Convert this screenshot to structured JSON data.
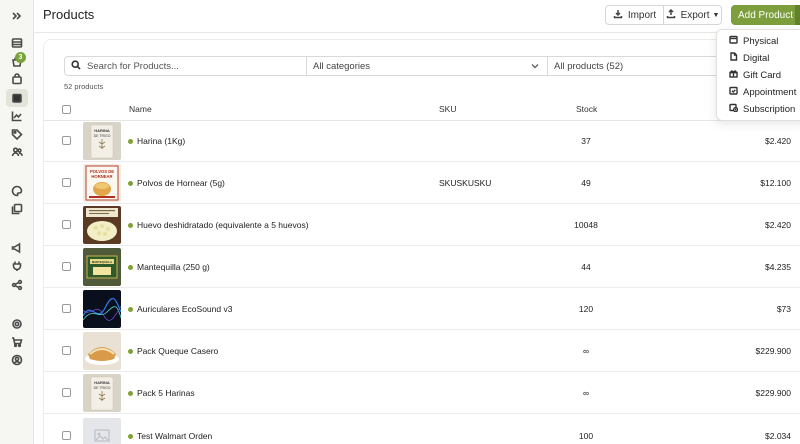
{
  "page": {
    "title": "Products"
  },
  "toolbar": {
    "import_label": "Import",
    "export_label": "Export",
    "add_label": "Add Product"
  },
  "add_menu": {
    "items": [
      {
        "label": "Physical",
        "icon": "box-icon"
      },
      {
        "label": "Digital",
        "icon": "file-icon"
      },
      {
        "label": "Gift Card",
        "icon": "gift-icon"
      },
      {
        "label": "Appointment",
        "icon": "calendar-check-icon"
      },
      {
        "label": "Subscription",
        "icon": "calendar-clock-icon"
      }
    ]
  },
  "sidebar": {
    "badge": "3",
    "icons": [
      "expand-icon",
      "storefront-icon",
      "orders-icon",
      "bag-icon",
      "products-icon",
      "analytics-icon",
      "tag-icon",
      "customers-icon",
      "palette-icon",
      "pages-icon",
      "megaphone-icon",
      "plug-icon",
      "share-icon",
      "settings-icon",
      "cart-icon",
      "account-icon"
    ]
  },
  "filters": {
    "search_placeholder": "Search for Products...",
    "category": "All categories",
    "products": "All products (52)"
  },
  "count_text": "52 products",
  "table": {
    "headers": {
      "name": "Name",
      "sku": "SKU",
      "stock": "Stock"
    },
    "rows": [
      {
        "name": "Harina (1Kg)",
        "sku": "",
        "stock": "37",
        "price": "$2.420",
        "status_color": "#7ea238"
      },
      {
        "name": "Polvos de Hornear (5g)",
        "sku": "SKUSKUSKU",
        "stock": "49",
        "price": "$12.100",
        "status_color": "#7ea238"
      },
      {
        "name": "Huevo deshidratado (equivalente a 5 huevos)",
        "sku": "",
        "stock": "10048",
        "price": "$2.420",
        "status_color": "#7ea238"
      },
      {
        "name": "Mantequilla (250 g)",
        "sku": "",
        "stock": "44",
        "price": "$4.235",
        "status_color": "#7ea238"
      },
      {
        "name": "Auriculares EcoSound v3",
        "sku": "",
        "stock": "120",
        "price": "$73",
        "status_color": "#7ea238"
      },
      {
        "name": "Pack Queque Casero",
        "sku": "",
        "stock": "∞",
        "price": "$229.900",
        "status_color": "#7ea238"
      },
      {
        "name": "Pack 5 Harinas",
        "sku": "",
        "stock": "∞",
        "price": "$229.900",
        "status_color": "#7ea238"
      },
      {
        "name": "Test Walmart Orden",
        "sku": "",
        "stock": "100",
        "price": "$2.034",
        "status_color": "#7ea238"
      }
    ]
  },
  "thumbnails": {
    "harina": {
      "line1": "HARINA",
      "line2": "DE TRIGO"
    },
    "polvos": {
      "line1": "POLVOS DE",
      "line2": "HORNEAR"
    },
    "mantequilla": {
      "line1": "MANTEQUILLA"
    }
  },
  "colors": {
    "accent": "#7d9e3c",
    "status_active": "#7ea238"
  }
}
